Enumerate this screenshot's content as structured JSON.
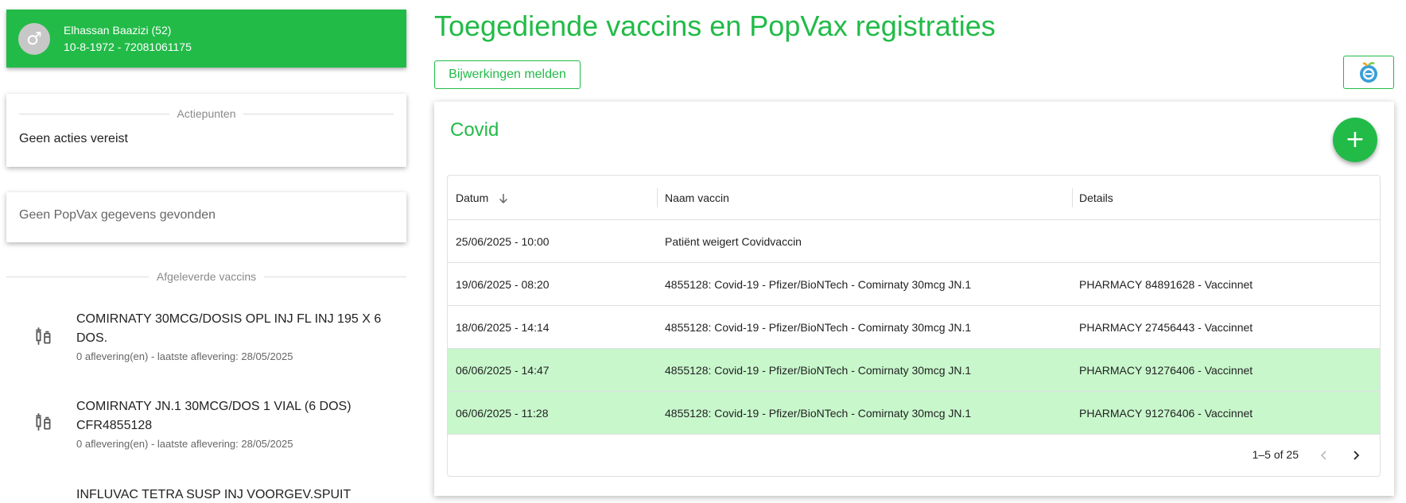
{
  "patient": {
    "gender_symbol": "♂",
    "name": "Elhassan Baazizi (52)",
    "dob_id": "10-8-1972 - 72081061175"
  },
  "actions": {
    "title": "Actiepunten",
    "text": "Geen acties vereist"
  },
  "popvax": {
    "text": "Geen PopVax gegevens gevonden"
  },
  "delivered": {
    "title": "Afgeleverde vaccins",
    "items": [
      {
        "name": "COMIRNATY 30MCG/DOSIS OPL INJ FL INJ 195 X 6 DOS.",
        "sub": "0 aflevering(en) - laatste aflevering: 28/05/2025"
      },
      {
        "name": "COMIRNATY JN.1 30MCG/DOS 1 VIAL (6 DOS) CFR4855128",
        "sub": "0 aflevering(en) - laatste aflevering: 28/05/2025"
      },
      {
        "name": "INFLUVAC TETRA SUSP INJ VOORGEV.SPUIT",
        "sub": ""
      }
    ]
  },
  "main": {
    "title": "Toegediende vaccins en PopVax registraties",
    "report_button": "Bijwerkingen melden",
    "logo_icon": "ehealth-logo-icon"
  },
  "covid": {
    "title": "Covid",
    "add_button": "+",
    "columns": [
      "Datum",
      "Naam vaccin",
      "Details"
    ],
    "rows": [
      {
        "date": "25/06/2025 - 10:00",
        "name": "Patiënt weigert Covidvaccin",
        "details": "",
        "highlight": false
      },
      {
        "date": "19/06/2025 - 08:20",
        "name": "4855128: Covid-19 - Pfizer/BioNTech - Comirnaty 30mcg JN.1",
        "details": "PHARMACY 84891628 - Vaccinnet",
        "highlight": false
      },
      {
        "date": "18/06/2025 - 14:14",
        "name": "4855128: Covid-19 - Pfizer/BioNTech - Comirnaty 30mcg JN.1",
        "details": "PHARMACY 27456443 - Vaccinnet",
        "highlight": false
      },
      {
        "date": "06/06/2025 - 14:47",
        "name": "4855128: Covid-19 - Pfizer/BioNTech - Comirnaty 30mcg JN.1",
        "details": "PHARMACY 91276406 - Vaccinnet",
        "highlight": true
      },
      {
        "date": "06/06/2025 - 11:28",
        "name": "4855128: Covid-19 - Pfizer/BioNTech - Comirnaty 30mcg JN.1",
        "details": "PHARMACY 91276406 - Vaccinnet",
        "highlight": true
      }
    ],
    "pagination": "1–5 of 25"
  },
  "colors": {
    "accent": "#22bb48",
    "highlight_row": "#c8f7cc"
  }
}
